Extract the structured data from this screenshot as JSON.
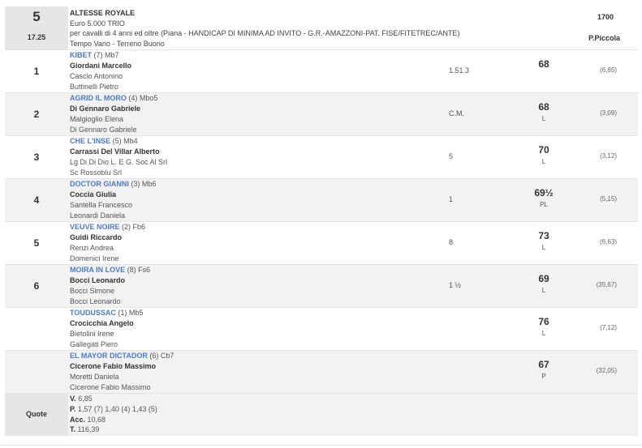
{
  "race": {
    "number": "5",
    "time": "17.25",
    "title": "ALTESSE ROYALE",
    "prize": "Euro 5.000 TRIO",
    "conditions": "per cavalli di 4 anni ed oltre (Piana -  HANDICAP DI MINIMA AD INVITO  - G.R.-AMAZZONI-PAT. FISE/FITETREC/ANTE)",
    "weather_ground": "Tempo Vario - Terreno Buono",
    "distance": "1700",
    "track": "P.Piccola"
  },
  "runners": [
    {
      "pos": "1",
      "horse": "KIBET",
      "extra": " (7) Mb7",
      "jockey": "Giordani Marcello",
      "trainer": "Cascio Antonino",
      "owner": "Buttinelli Pietro",
      "owner2": "",
      "dist": "1.51.3",
      "weight": "68",
      "note": "",
      "odds": "(6,85)"
    },
    {
      "pos": "2",
      "horse": "AGRID IL MORO",
      "extra": " (4) Mbo5",
      "jockey": "Di Gennaro Gabriele",
      "trainer": "Malgioglio Elena",
      "owner": "Di Gennaro Gabriele",
      "owner2": "",
      "dist": "C.M.",
      "weight": "68",
      "note": "L",
      "odds": "(3,09)"
    },
    {
      "pos": "3",
      "horse": "CHE L'INSE",
      "extra": " (5) Mb4",
      "jockey": "Carrassi Del Villar Alberto",
      "trainer": "Lg Di Di Dio L. E G. Soc Al Srl",
      "owner": "Sc Rossoblu Srl",
      "owner2": "",
      "dist": "5",
      "weight": "70",
      "note": "L",
      "odds": "(3,12)"
    },
    {
      "pos": "4",
      "horse": "DOCTOR GIANNI",
      "extra": " (3) Mb6",
      "jockey": "Coccia Giulia",
      "trainer": "Santella Francesco",
      "owner": "Leonardi Daniela",
      "owner2": "",
      "dist": "1",
      "weight": "69½",
      "note": "PL",
      "odds": "(5,15)"
    },
    {
      "pos": "5",
      "horse": "VEUVE NOIRE",
      "extra": " (2) Fb6",
      "jockey": "Guidi Riccardo",
      "trainer": "Renzi Andrea",
      "owner": "Domenici Irene",
      "owner2": "",
      "dist": "8",
      "weight": "73",
      "note": "L",
      "odds": "(6,63)"
    },
    {
      "pos": "6",
      "horse": "MOIRA IN LOVE",
      "extra": " (8) Fs6",
      "jockey": "Bocci Leonardo",
      "trainer": "Bocci Simone",
      "owner": "Bocci Leonardo",
      "owner2": "",
      "dist": "1 ½",
      "weight": "69",
      "note": "L",
      "odds": "(35,67)"
    },
    {
      "pos": "",
      "horse": "TOUDUSSAC",
      "extra": " (1) Mb5",
      "jockey": "Crocicchia Angelo",
      "trainer": "Bietolini Irene",
      "owner": "Gallegati Piero",
      "owner2": "",
      "dist": "",
      "weight": "76",
      "note": "L",
      "odds": "(7,12)"
    },
    {
      "pos": "",
      "horse": "EL MAYOR DICTADOR",
      "extra": " (6) Cb7",
      "jockey": "Cicerone Fabio Massimo",
      "trainer": "Moretti Daniela",
      "owner": "Cicerone Fabio Massimo",
      "owner2": "",
      "dist": "",
      "weight": "67",
      "note": "P",
      "odds": "(32,05)"
    }
  ],
  "quote": {
    "label": "Quote",
    "v_label": "V.",
    "v_value": " 6,85",
    "p_label": "P.",
    "p_value": " 1,57 (7)  1,40 (4)  1,43 (5)",
    "acc_label": "Acc.",
    "acc_value": " 10,68",
    "t_label": "T.",
    "t_value": " 116,39"
  }
}
